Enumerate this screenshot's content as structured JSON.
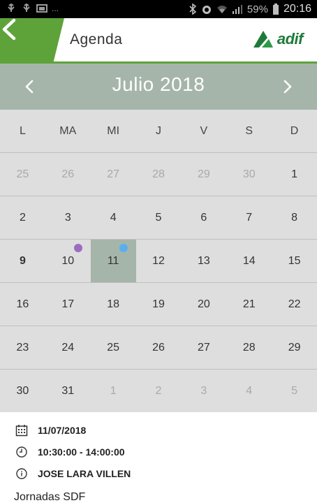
{
  "status_bar": {
    "left_icons": [
      "usb-icon",
      "usb-icon",
      "image-icon"
    ],
    "more": "...",
    "battery_percent": "59%",
    "time": "20:16"
  },
  "app_bar": {
    "title": "Agenda",
    "back_icon": "chevron-left-icon",
    "logo_text": "adif",
    "accent_color": "#5ea33a",
    "logo_color": "#1f7a3a"
  },
  "calendar": {
    "month_label": "Julio 2018",
    "header_color": "#a6b5a9",
    "weekdays": [
      "L",
      "MA",
      "MI",
      "J",
      "V",
      "S",
      "D"
    ],
    "weeks": [
      [
        "25",
        "26",
        "27",
        "28",
        "29",
        "30",
        "1"
      ],
      [
        "2",
        "3",
        "4",
        "5",
        "6",
        "7",
        "8"
      ],
      [
        "9",
        "10",
        "11",
        "12",
        "13",
        "14",
        "15"
      ],
      [
        "16",
        "17",
        "18",
        "19",
        "20",
        "21",
        "22"
      ],
      [
        "23",
        "24",
        "25",
        "26",
        "27",
        "28",
        "29"
      ],
      [
        "30",
        "31",
        "1",
        "2",
        "3",
        "4",
        "5"
      ]
    ],
    "selected_day": "11",
    "today": "9",
    "event_dot_colors": {
      "purple": "#9b6dbf",
      "blue": "#5aaef0"
    }
  },
  "details": {
    "date": "11/07/2018",
    "time_range": "10:30:00 - 14:00:00",
    "person": "JOSE LARA VILLEN",
    "event_title": "Jornadas SDF"
  }
}
